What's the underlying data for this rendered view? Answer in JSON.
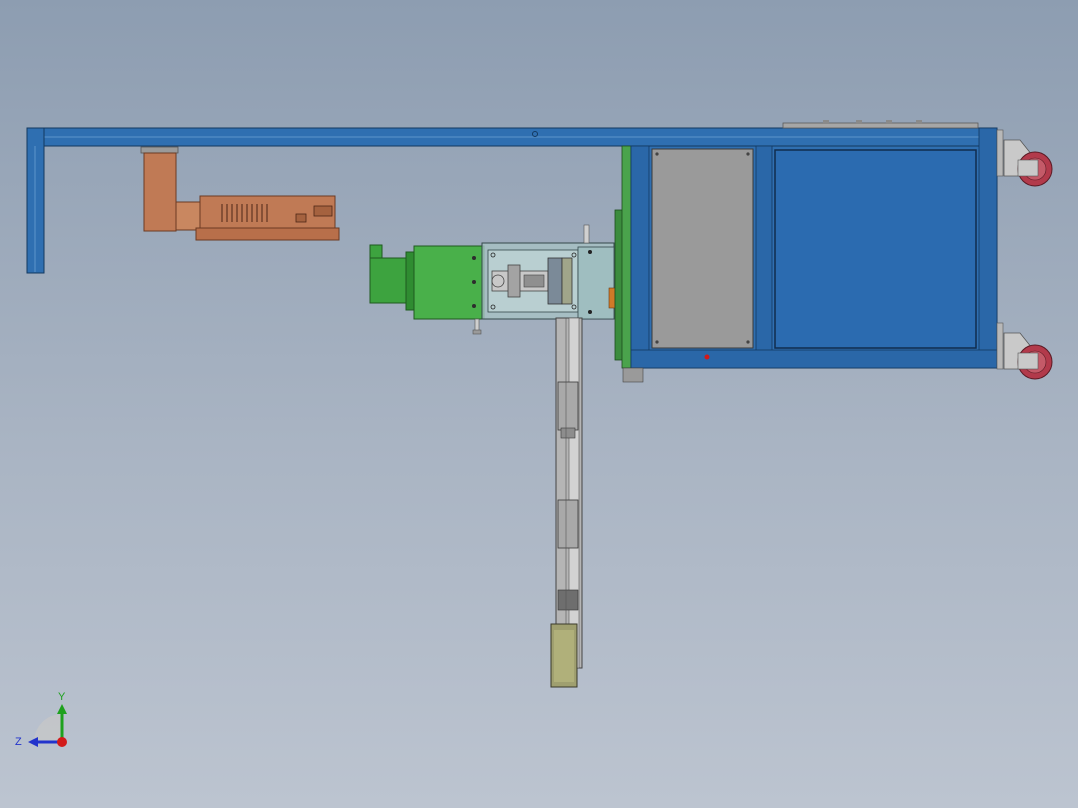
{
  "viewport": {
    "background_top": "#8d9db1",
    "background_bottom": "#bcc4d0"
  },
  "model": {
    "frame_color": "#2f6fb1",
    "frame_dark": "#1c4f86",
    "motor_color": "#3da33f",
    "copper_color": "#c07a55",
    "panel_gray": "#9a9a9a",
    "caster_color": "#b23a4b"
  },
  "triad": {
    "y_label": "Y",
    "z_label": "Z",
    "y_color": "#1ea11e",
    "z_color": "#2233cc",
    "x_color": "#d21a1a"
  }
}
